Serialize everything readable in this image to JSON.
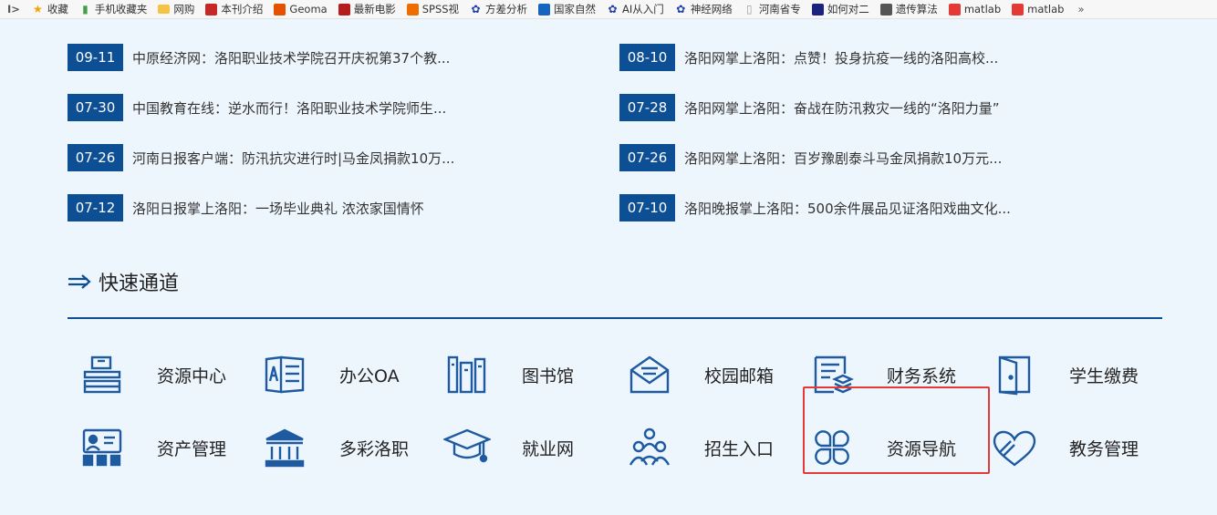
{
  "bookmarks": {
    "first": "I>",
    "items": [
      {
        "label": "收藏",
        "icon": "star-icon",
        "color": "#f4a300"
      },
      {
        "label": "手机收藏夹",
        "icon": "phone-icon",
        "color": "#43a047"
      },
      {
        "label": "网购",
        "icon": "folder-icon",
        "color": "#f5c242"
      },
      {
        "label": "本刊介绍",
        "icon": "site-icon",
        "color": "#c62828"
      },
      {
        "label": "Geoma",
        "icon": "site-icon",
        "color": "#e65100"
      },
      {
        "label": "最新电影",
        "icon": "site-icon",
        "color": "#b71c1c"
      },
      {
        "label": "SPSS视",
        "icon": "site-icon",
        "color": "#ef6c00"
      },
      {
        "label": "方差分析",
        "icon": "paw-icon",
        "color": "#1e3fa8"
      },
      {
        "label": "国家自然",
        "icon": "site-icon",
        "color": "#1565c0"
      },
      {
        "label": "AI从入门",
        "icon": "paw-icon",
        "color": "#1e3fa8"
      },
      {
        "label": "神经网络",
        "icon": "paw-icon",
        "color": "#1e3fa8"
      },
      {
        "label": "河南省专",
        "icon": "page-icon",
        "color": "#9e9e9e"
      },
      {
        "label": "如何对二",
        "icon": "site-icon",
        "color": "#1a237e"
      },
      {
        "label": "遗传算法",
        "icon": "site-icon",
        "color": "#555555"
      },
      {
        "label": "matlab",
        "icon": "site-icon",
        "color": "#e53935"
      },
      {
        "label": "matlab",
        "icon": "site-icon",
        "color": "#e53935"
      }
    ],
    "more": "»"
  },
  "news": {
    "left": [
      {
        "date": "09-11",
        "title": "中原经济网：洛阳职业技术学院召开庆祝第37个教..."
      },
      {
        "date": "07-30",
        "title": "中国教育在线：逆水而行！洛阳职业技术学院师生..."
      },
      {
        "date": "07-26",
        "title": "河南日报客户端：防汛抗灾进行时|马金凤捐款10万..."
      },
      {
        "date": "07-12",
        "title": "洛阳日报掌上洛阳：一场毕业典礼 浓浓家国情怀"
      }
    ],
    "right": [
      {
        "date": "08-10",
        "title": "洛阳网掌上洛阳：点赞！投身抗疫一线的洛阳高校..."
      },
      {
        "date": "07-28",
        "title": "洛阳网掌上洛阳：奋战在防汛救灾一线的“洛阳力量”"
      },
      {
        "date": "07-26",
        "title": "洛阳网掌上洛阳：百岁豫剧泰斗马金凤捐款10万元..."
      },
      {
        "date": "07-10",
        "title": "洛阳晚报掌上洛阳：500余件展品见证洛阳戏曲文化..."
      }
    ]
  },
  "quick_channel": {
    "title": "快速通道",
    "accent": "#0d4f95",
    "items": [
      {
        "label": "资源中心",
        "icon": "desk-icon"
      },
      {
        "label": "办公OA",
        "icon": "id-card-icon"
      },
      {
        "label": "图书馆",
        "icon": "books-icon"
      },
      {
        "label": "校园邮箱",
        "icon": "mail-icon"
      },
      {
        "label": "财务系统",
        "icon": "finance-doc-icon"
      },
      {
        "label": "学生缴费",
        "icon": "door-icon"
      },
      {
        "label": "资产管理",
        "icon": "presentation-icon"
      },
      {
        "label": "多彩洛职",
        "icon": "building-icon"
      },
      {
        "label": "就业网",
        "icon": "graduation-cap-icon"
      },
      {
        "label": "招生入口",
        "icon": "people-icon"
      },
      {
        "label": "资源导航",
        "icon": "clover-icon"
      },
      {
        "label": "教务管理",
        "icon": "heart-icon"
      }
    ]
  },
  "highlight_color": "#e53935"
}
